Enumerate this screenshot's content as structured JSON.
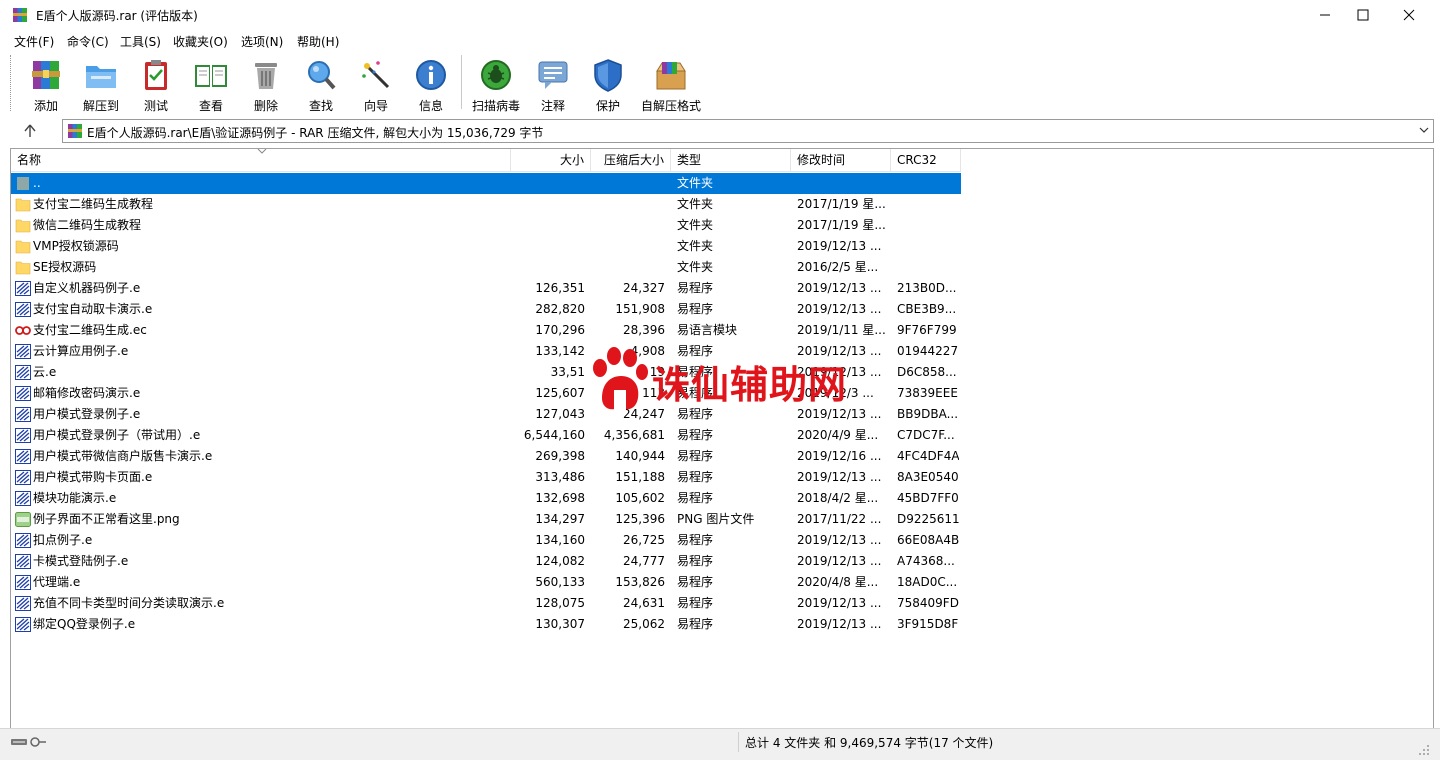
{
  "window": {
    "title": "E盾个人版源码.rar (评估版本)"
  },
  "menu": [
    "文件(F)",
    "命令(C)",
    "工具(S)",
    "收藏夹(O)",
    "选项(N)",
    "帮助(H)"
  ],
  "toolbar": {
    "buttons": [
      {
        "label": "添加",
        "icon": "add-archive-icon"
      },
      {
        "label": "解压到",
        "icon": "extract-folder-icon"
      },
      {
        "label": "测试",
        "icon": "test-clipboard-icon"
      },
      {
        "label": "查看",
        "icon": "view-book-icon"
      },
      {
        "label": "删除",
        "icon": "trash-icon"
      },
      {
        "label": "查找",
        "icon": "magnifier-icon"
      },
      {
        "label": "向导",
        "icon": "wand-icon"
      },
      {
        "label": "信息",
        "icon": "info-icon"
      },
      {
        "label": "扫描病毒",
        "icon": "virus-scan-icon"
      },
      {
        "label": "注释",
        "icon": "comment-icon"
      },
      {
        "label": "保护",
        "icon": "shield-icon"
      },
      {
        "label": "自解压格式",
        "icon": "sfx-box-icon"
      }
    ]
  },
  "address": {
    "path": "E盾个人版源码.rar\\E盾\\验证源码例子 - RAR 压缩文件, 解包大小为 15,036,729 字节"
  },
  "columns": {
    "name": "名称",
    "size": "大小",
    "packed": "压缩后大小",
    "type": "类型",
    "modified": "修改时间",
    "crc": "CRC32"
  },
  "files": [
    {
      "name": "..",
      "size": "",
      "packed": "",
      "type": "文件夹",
      "modified": "",
      "crc": "",
      "icon": "up",
      "selected": true
    },
    {
      "name": "支付宝二维码生成教程",
      "size": "",
      "packed": "",
      "type": "文件夹",
      "modified": "2017/1/19 星...",
      "crc": "",
      "icon": "folder"
    },
    {
      "name": "微信二维码生成教程",
      "size": "",
      "packed": "",
      "type": "文件夹",
      "modified": "2017/1/19 星...",
      "crc": "",
      "icon": "folder"
    },
    {
      "name": "VMP授权锁源码",
      "size": "",
      "packed": "",
      "type": "文件夹",
      "modified": "2019/12/13 ...",
      "crc": "",
      "icon": "folder"
    },
    {
      "name": "SE授权源码",
      "size": "",
      "packed": "",
      "type": "文件夹",
      "modified": "2016/2/5 星...",
      "crc": "",
      "icon": "folder"
    },
    {
      "name": "自定义机器码例子.e",
      "size": "126,351",
      "packed": "24,327",
      "type": "易程序",
      "modified": "2019/12/13 ...",
      "crc": "213B0D...",
      "icon": "e"
    },
    {
      "name": "支付宝自动取卡演示.e",
      "size": "282,820",
      "packed": "151,908",
      "type": "易程序",
      "modified": "2019/12/13 ...",
      "crc": "CBE3B9...",
      "icon": "e"
    },
    {
      "name": "支付宝二维码生成.ec",
      "size": "170,296",
      "packed": "28,396",
      "type": "易语言模块",
      "modified": "2019/1/11 星...",
      "crc": "9F76F799",
      "icon": "ec"
    },
    {
      "name": "云计算应用例子.e",
      "size": "133,142",
      "packed": "4,908",
      "type": "易程序",
      "modified": "2019/12/13 ...",
      "crc": "01944227",
      "icon": "e"
    },
    {
      "name": "云.e",
      "size": "33,51",
      "packed": "19",
      "type": "易程序",
      "modified": "2019/12/13 ...",
      "crc": "D6C858...",
      "icon": "e"
    },
    {
      "name": "邮箱修改密码演示.e",
      "size": "125,607",
      "packed": "113",
      "type": "易程序",
      "modified": "2019/12/3 ...",
      "crc": "73839EEE",
      "icon": "e"
    },
    {
      "name": "用户模式登录例子.e",
      "size": "127,043",
      "packed": "24,247",
      "type": "易程序",
      "modified": "2019/12/13 ...",
      "crc": "BB9DBA...",
      "icon": "e"
    },
    {
      "name": "用户模式登录例子（带试用）.e",
      "size": "6,544,160",
      "packed": "4,356,681",
      "type": "易程序",
      "modified": "2020/4/9 星...",
      "crc": "C7DC7F...",
      "icon": "e"
    },
    {
      "name": "用户模式带微信商户版售卡演示.e",
      "size": "269,398",
      "packed": "140,944",
      "type": "易程序",
      "modified": "2019/12/16 ...",
      "crc": "4FC4DF4A",
      "icon": "e"
    },
    {
      "name": "用户模式带购卡页面.e",
      "size": "313,486",
      "packed": "151,188",
      "type": "易程序",
      "modified": "2019/12/13 ...",
      "crc": "8A3E0540",
      "icon": "e"
    },
    {
      "name": "模块功能演示.e",
      "size": "132,698",
      "packed": "105,602",
      "type": "易程序",
      "modified": "2018/4/2 星...",
      "crc": "45BD7FF0",
      "icon": "e"
    },
    {
      "name": "例子界面不正常看这里.png",
      "size": "134,297",
      "packed": "125,396",
      "type": "PNG 图片文件",
      "modified": "2017/11/22 ...",
      "crc": "D9225611",
      "icon": "png"
    },
    {
      "name": "扣点例子.e",
      "size": "134,160",
      "packed": "26,725",
      "type": "易程序",
      "modified": "2019/12/13 ...",
      "crc": "66E08A4B",
      "icon": "e"
    },
    {
      "name": "卡模式登陆例子.e",
      "size": "124,082",
      "packed": "24,777",
      "type": "易程序",
      "modified": "2019/12/13 ...",
      "crc": "A74368...",
      "icon": "e"
    },
    {
      "name": "代理端.e",
      "size": "560,133",
      "packed": "153,826",
      "type": "易程序",
      "modified": "2020/4/8 星...",
      "crc": "18AD0C...",
      "icon": "e"
    },
    {
      "name": "充值不同卡类型时间分类读取演示.e",
      "size": "128,075",
      "packed": "24,631",
      "type": "易程序",
      "modified": "2019/12/13 ...",
      "crc": "758409FD",
      "icon": "e"
    },
    {
      "name": "绑定QQ登录例子.e",
      "size": "130,307",
      "packed": "25,062",
      "type": "易程序",
      "modified": "2019/12/13 ...",
      "crc": "3F915D8F",
      "icon": "e"
    }
  ],
  "status": {
    "summary": "总计 4 文件夹 和 9,469,574 字节(17 个文件)"
  },
  "watermark": {
    "text": "诛仙辅助网"
  },
  "colors": {
    "selection": "#0078d7",
    "folder": "#ffd766",
    "watermark": "#e0141b"
  }
}
